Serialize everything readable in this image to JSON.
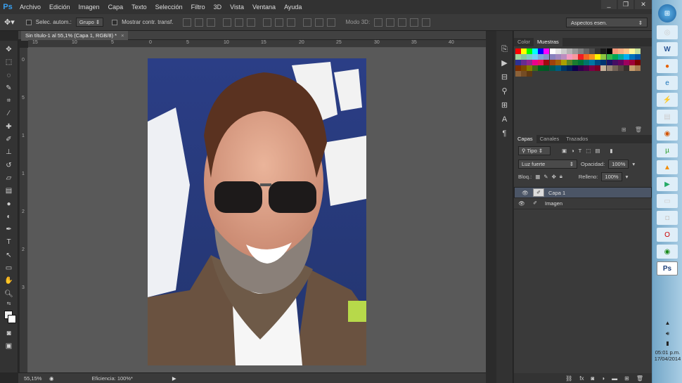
{
  "app": {
    "logo": "Ps",
    "menus": [
      "Archivo",
      "Edición",
      "Imagen",
      "Capa",
      "Texto",
      "Selección",
      "Filtro",
      "3D",
      "Vista",
      "Ventana",
      "Ayuda"
    ],
    "win_buttons": [
      "_",
      "❐",
      "✕"
    ]
  },
  "options": {
    "auto_select_label": "Selec. autom.:",
    "auto_select_target": "Grupo",
    "show_transform_label": "Mostrar contr. transf.",
    "mode3d_label": "Modo 3D:"
  },
  "workspace": {
    "value": "Aspectos esen."
  },
  "document": {
    "tab_title": "Sin título-1 al 55,1% (Capa 1, RGB/8) *",
    "close": "×"
  },
  "rulers": {
    "top": [
      "15",
      "10",
      "5",
      "0",
      "5",
      "10",
      "15",
      "20",
      "25",
      "30",
      "35",
      "40"
    ],
    "left": [
      "0",
      "5",
      "1",
      "1",
      "2",
      "2",
      "3"
    ]
  },
  "status": {
    "zoom": "55,15%",
    "info": "Eficiencia: 100%*"
  },
  "swatch_tabs": [
    "Color",
    "Muestras"
  ],
  "swatch_colors": [
    "#ff0000",
    "#ffff00",
    "#00ff00",
    "#00ffff",
    "#0000ff",
    "#ff00ff",
    "#ffffff",
    "#e6e6e6",
    "#cccccc",
    "#b3b3b3",
    "#999999",
    "#808080",
    "#666666",
    "#4d4d4d",
    "#333333",
    "#1a1a1a",
    "#000000",
    "#f7977a",
    "#f9ad81",
    "#fdc68a",
    "#fff79a",
    "#c4df9b",
    "#a3d39c",
    "#82ca9d",
    "#7bcdc8",
    "#6ecff6",
    "#7ea7d8",
    "#8493ca",
    "#8882be",
    "#a187be",
    "#bc8dbf",
    "#f49ac2",
    "#f6989d",
    "#ed1c24",
    "#f26522",
    "#f7941d",
    "#fff200",
    "#8dc73f",
    "#39b54a",
    "#00a651",
    "#00a99d",
    "#00aeef",
    "#0072bc",
    "#0054a6",
    "#2e3192",
    "#662d91",
    "#92278f",
    "#ec008c",
    "#ed145b",
    "#9e0b0f",
    "#a0410d",
    "#a36209",
    "#aba000",
    "#598527",
    "#1a7b30",
    "#007236",
    "#00746b",
    "#0076a3",
    "#004b80",
    "#003471",
    "#1b1464",
    "#440e62",
    "#630460",
    "#9e005d",
    "#9e0039",
    "#790000",
    "#7b2e00",
    "#7d4900",
    "#827b00",
    "#406618",
    "#005e20",
    "#005826",
    "#005952",
    "#005b7f",
    "#003663",
    "#002157",
    "#0d004c",
    "#32004b",
    "#4b0049",
    "#7b0046",
    "#7a0026",
    "#c7b299",
    "#998675",
    "#736357",
    "#534741",
    "#37302d",
    "#c69c6d",
    "#a67c52",
    "#8c6239",
    "#754c24",
    "#603913"
  ],
  "layers": {
    "tabs": [
      "Capas",
      "Canales",
      "Trazados"
    ],
    "filter_kind": "Tipo",
    "blend_mode": "Luz fuerte",
    "opacity_label": "Opacidad:",
    "opacity": "100%",
    "lock_label": "Bloq.:",
    "fill_label": "Relleno:",
    "fill": "100%",
    "items": [
      {
        "name": "Capa 1",
        "selected": true
      },
      {
        "name": "Imagen",
        "selected": false
      }
    ]
  },
  "clock": {
    "time": "05:01 p.m.",
    "date": "17/04/2014"
  }
}
